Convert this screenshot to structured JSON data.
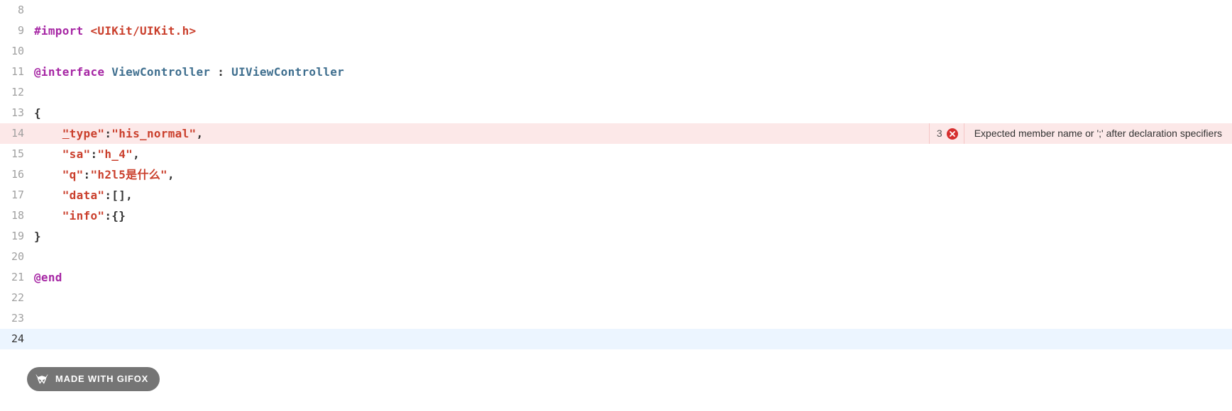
{
  "editor": {
    "lines": [
      {
        "num": "8",
        "tokens": []
      },
      {
        "num": "9",
        "tokens": [
          {
            "text": "#import ",
            "cls": "tok-keyword"
          },
          {
            "text": "<UIKit/UIKit.h>",
            "cls": "tok-import-path"
          }
        ]
      },
      {
        "num": "10",
        "tokens": []
      },
      {
        "num": "11",
        "tokens": [
          {
            "text": "@interface",
            "cls": "tok-keyword"
          },
          {
            "text": " ",
            "cls": ""
          },
          {
            "text": "ViewController",
            "cls": "tok-classname"
          },
          {
            "text": " : ",
            "cls": "tok-punct"
          },
          {
            "text": "UIViewController",
            "cls": "tok-classname"
          }
        ]
      },
      {
        "num": "12",
        "tokens": []
      },
      {
        "num": "13",
        "tokens": [
          {
            "text": "{",
            "cls": "tok-punct"
          }
        ]
      },
      {
        "num": "14",
        "error": true,
        "tokens": [
          {
            "text": "    ",
            "cls": ""
          },
          {
            "text": "\"",
            "cls": "tok-string tok-underline"
          },
          {
            "text": "type\"",
            "cls": "tok-string"
          },
          {
            "text": ":",
            "cls": "tok-punct"
          },
          {
            "text": "\"his_normal\"",
            "cls": "tok-string"
          },
          {
            "text": ",",
            "cls": "tok-punct"
          }
        ]
      },
      {
        "num": "15",
        "tokens": [
          {
            "text": "    ",
            "cls": ""
          },
          {
            "text": "\"sa\"",
            "cls": "tok-string"
          },
          {
            "text": ":",
            "cls": "tok-punct"
          },
          {
            "text": "\"h_4\"",
            "cls": "tok-string"
          },
          {
            "text": ",",
            "cls": "tok-punct"
          }
        ]
      },
      {
        "num": "16",
        "tokens": [
          {
            "text": "    ",
            "cls": ""
          },
          {
            "text": "\"q\"",
            "cls": "tok-string"
          },
          {
            "text": ":",
            "cls": "tok-punct"
          },
          {
            "text": "\"h2l5是什么\"",
            "cls": "tok-string"
          },
          {
            "text": ",",
            "cls": "tok-punct"
          }
        ]
      },
      {
        "num": "17",
        "tokens": [
          {
            "text": "    ",
            "cls": ""
          },
          {
            "text": "\"data\"",
            "cls": "tok-string"
          },
          {
            "text": ":[],",
            "cls": "tok-punct"
          }
        ]
      },
      {
        "num": "18",
        "tokens": [
          {
            "text": "    ",
            "cls": ""
          },
          {
            "text": "\"info\"",
            "cls": "tok-string"
          },
          {
            "text": ":{}",
            "cls": "tok-punct"
          }
        ]
      },
      {
        "num": "19",
        "tokens": [
          {
            "text": "}",
            "cls": "tok-punct"
          }
        ]
      },
      {
        "num": "20",
        "tokens": []
      },
      {
        "num": "21",
        "tokens": [
          {
            "text": "@end",
            "cls": "tok-keyword"
          }
        ]
      },
      {
        "num": "22",
        "tokens": []
      },
      {
        "num": "23",
        "tokens": []
      },
      {
        "num": "24",
        "cursor": true,
        "tokens": []
      }
    ],
    "error": {
      "count": "3",
      "message": "Expected member name or ';' after declaration specifiers"
    }
  },
  "gifox": {
    "label": "MADE WITH GIFOX"
  }
}
